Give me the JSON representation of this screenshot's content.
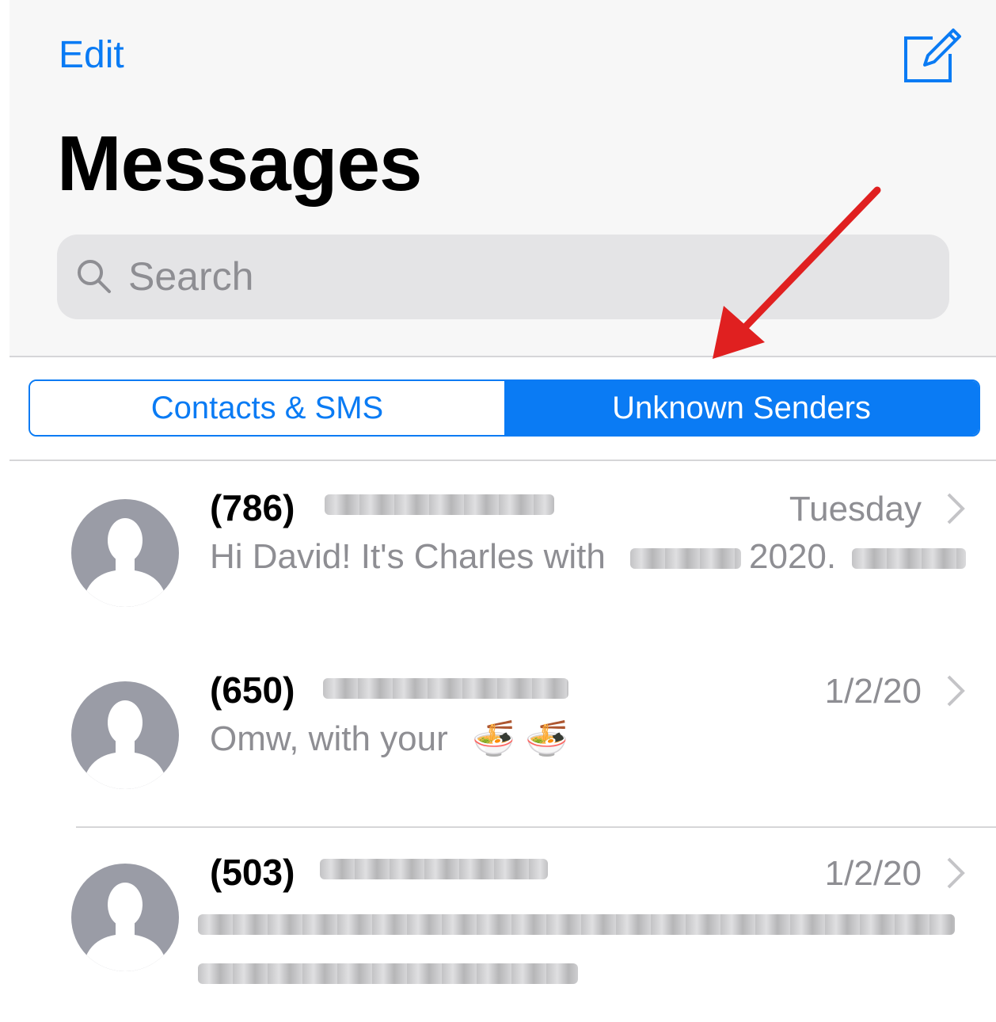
{
  "header": {
    "edit_label": "Edit",
    "compose_icon": "compose-icon",
    "title": "Messages"
  },
  "search": {
    "placeholder": "Search"
  },
  "filter": {
    "left_label": "Contacts & SMS",
    "right_label": "Unknown Senders",
    "selected": "Unknown Senders"
  },
  "messages": [
    {
      "sender": "(786)",
      "date": "Tuesday",
      "preview": "Hi David! It's Charles with",
      "preview_2": "2020."
    },
    {
      "sender": "(650)",
      "date": "1/2/20",
      "preview": "Omw, with your",
      "emoji": "🍜 🍜"
    },
    {
      "sender": "(503)",
      "date": "1/2/20",
      "preview": ""
    }
  ],
  "colors": {
    "accent": "#0a7bf4",
    "secondary_text": "#8e8e93",
    "annotation_arrow": "#e02020"
  }
}
